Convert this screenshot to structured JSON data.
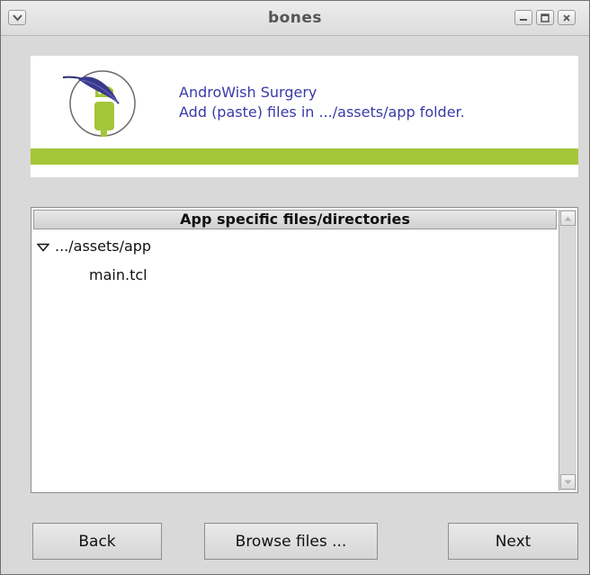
{
  "window": {
    "title": "bones"
  },
  "header": {
    "line1": "AndroWish Surgery",
    "line2": "Add (paste) files in .../assets/app folder.",
    "accent_color": "#a4c639",
    "text_color": "#3a3aa8"
  },
  "tree": {
    "column_header": "App specific files/directories",
    "items": [
      {
        "label": ".../assets/app",
        "expanded": true
      },
      {
        "label": "main.tcl"
      }
    ]
  },
  "buttons": {
    "back": "Back",
    "browse": "Browse files ...",
    "next": "Next"
  },
  "icons": {
    "menu": "chevron-down-icon",
    "minimize": "minimize-icon",
    "maximize": "maximize-icon",
    "close": "close-icon",
    "logo": "androwish-logo"
  }
}
